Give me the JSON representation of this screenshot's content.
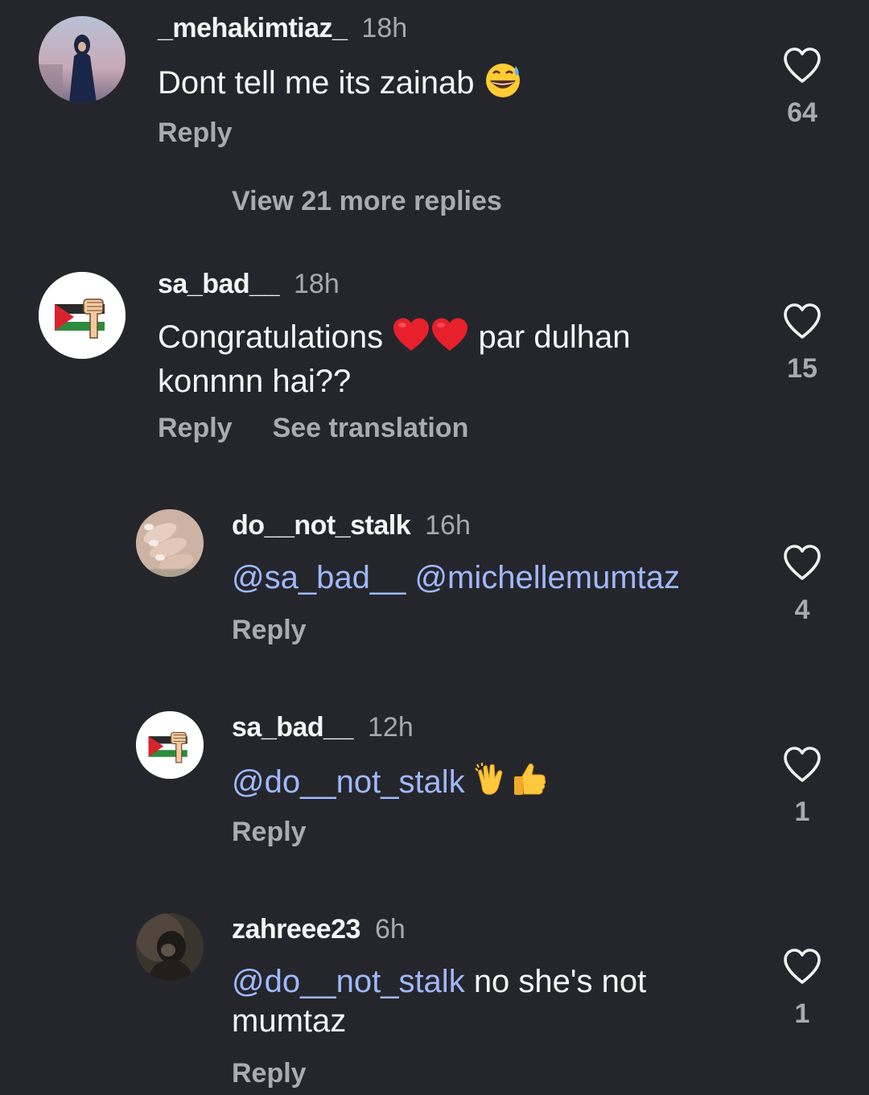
{
  "colors": {
    "background": "#25262b",
    "username": "#f5f5f5",
    "muted": "#a9abb2",
    "mention": "#9fb8ff"
  },
  "comments": [
    {
      "username": "_mehakimtiaz_",
      "time": "18h",
      "text": "Dont tell me its zainab",
      "emoji": "sweat-smile-emoji",
      "reply_label": "Reply",
      "likes": "64",
      "avatar": "profile-photo-woman"
    },
    {
      "view_more_label": "View 21 more replies"
    },
    {
      "username": "sa_bad__",
      "time": "18h",
      "text_before": "Congratulations",
      "text_after": "par dulhan konnnn hai??",
      "emoji": "red-heart-emoji-x2",
      "reply_label": "Reply",
      "translate_label": "See translation",
      "likes": "15",
      "avatar": "palestine-flag-fist"
    }
  ],
  "replies": [
    {
      "username": "do__not_stalk",
      "time": "16h",
      "mention1": "@sa_bad__",
      "mention2": "@michellemumtaz",
      "reply_label": "Reply",
      "likes": "4",
      "avatar": "hand-photo"
    },
    {
      "username": "sa_bad__",
      "time": "12h",
      "mention": "@do__not_stalk",
      "emoji": "clap-thumbs-up-emoji",
      "reply_label": "Reply",
      "likes": "1",
      "avatar": "palestine-flag-fist"
    },
    {
      "username": "zahreee23",
      "time": "6h",
      "mention": "@do__not_stalk",
      "text": "no she's not mumtaz",
      "reply_label": "Reply",
      "likes": "1",
      "avatar": "dark-profile-photo"
    }
  ]
}
